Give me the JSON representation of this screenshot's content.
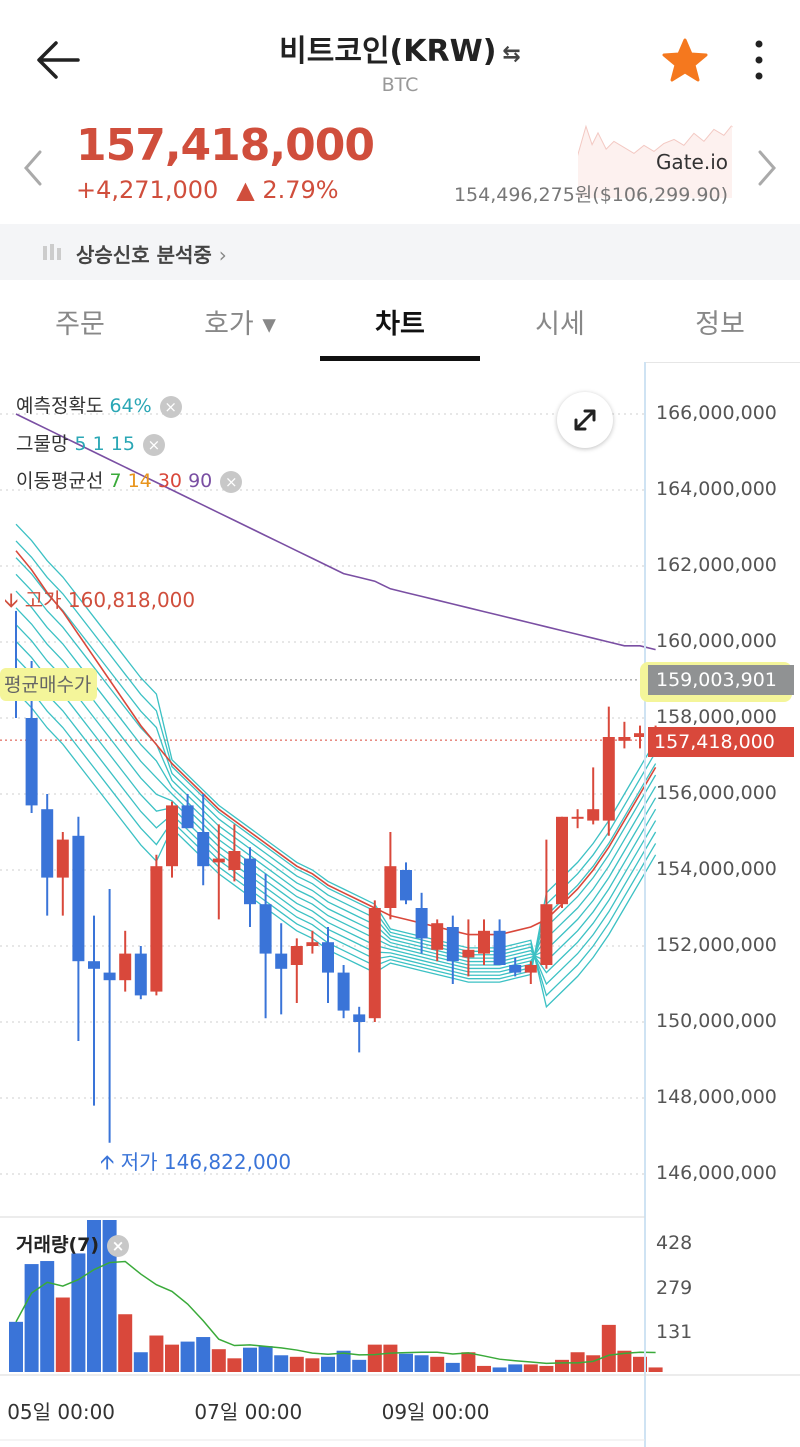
{
  "header": {
    "title": "비트코인(KRW)",
    "swap_icon": "⇆",
    "symbol": "BTC",
    "back_icon": "arrow-left-icon",
    "star_color": "#f5781e",
    "more_icon": "more-vertical-icon"
  },
  "ticker": {
    "price": "157,418,000",
    "change": "+4,271,000",
    "change_pct": "▲ 2.79%",
    "ref_exchange": "Gate.io",
    "ref_price": "154,496,275원($106,299.90)",
    "up_color": "#d04e3c"
  },
  "signal_bar": {
    "label": "상승신호 분석중",
    "chevron": "›"
  },
  "tabs": [
    {
      "label": "주문"
    },
    {
      "label": "호가 ▾"
    },
    {
      "label": "차트"
    },
    {
      "label": "시세"
    },
    {
      "label": "정보"
    }
  ],
  "active_tab": 2,
  "indicators": {
    "accuracy_label": "예측정확도",
    "accuracy_value": "64%",
    "grid_label": "그물망",
    "grid_params": "5 1 15",
    "ma_label": "이동평균선",
    "ma_7": "7",
    "ma_14": "14",
    "ma_30": "30",
    "ma_90": "90",
    "close": "×"
  },
  "chart_markers": {
    "high_label": "고가 160,818,000",
    "low_label": "저가 146,822,000",
    "avg_buy_label": "평균매수가",
    "avg_buy_value": "159,003,901",
    "current_value": "157,418,000"
  },
  "volume": {
    "label": "거래량(7)"
  },
  "chart_data": {
    "type": "candlestick",
    "ylim": [
      145000000,
      167000000
    ],
    "y_ticks": [
      "166,000,000",
      "164,000,000",
      "162,000,000",
      "160,000,000",
      "158,000,000",
      "156,000,000",
      "154,000,000",
      "152,000,000",
      "150,000,000",
      "148,000,000",
      "146,000,000"
    ],
    "y_tick_values": [
      166000000,
      164000000,
      162000000,
      160000000,
      158000000,
      156000000,
      154000000,
      152000000,
      150000000,
      148000000,
      146000000
    ],
    "x_ticks": [
      "05일 00:00",
      "07일 00:00",
      "09일 00:00"
    ],
    "x_tick_index": [
      2,
      14,
      26
    ],
    "avg_buy_price": 159003901,
    "current_price": 157418000,
    "colors": {
      "up": "#d9483b",
      "down": "#3a74d8",
      "ma7": "#d9483b",
      "ma90": "#7a4fa3",
      "grid": "#3cc1c4",
      "vol_ma": "#3aaa3a"
    },
    "candles": [
      {
        "o": 158900000,
        "h": 160818000,
        "l": 158000000,
        "c": 158800000
      },
      {
        "o": 158000000,
        "h": 159500000,
        "l": 155500000,
        "c": 155700000
      },
      {
        "o": 155600000,
        "h": 156000000,
        "l": 152800000,
        "c": 153800000
      },
      {
        "o": 153800000,
        "h": 155000000,
        "l": 152800000,
        "c": 154800000
      },
      {
        "o": 154900000,
        "h": 155400000,
        "l": 149500000,
        "c": 151600000
      },
      {
        "o": 151600000,
        "h": 152800000,
        "l": 147800000,
        "c": 151400000
      },
      {
        "o": 151300000,
        "h": 153500000,
        "l": 146822000,
        "c": 151100000
      },
      {
        "o": 151100000,
        "h": 152400000,
        "l": 150800000,
        "c": 151800000
      },
      {
        "o": 151800000,
        "h": 152000000,
        "l": 150600000,
        "c": 150700000
      },
      {
        "o": 150800000,
        "h": 154400000,
        "l": 150700000,
        "c": 154100000
      },
      {
        "o": 154100000,
        "h": 155800000,
        "l": 153800000,
        "c": 155700000
      },
      {
        "o": 155700000,
        "h": 156000000,
        "l": 155100000,
        "c": 155100000
      },
      {
        "o": 155000000,
        "h": 156000000,
        "l": 153600000,
        "c": 154100000
      },
      {
        "o": 154200000,
        "h": 155200000,
        "l": 152700000,
        "c": 154300000
      },
      {
        "o": 154000000,
        "h": 155200000,
        "l": 153700000,
        "c": 154500000
      },
      {
        "o": 154300000,
        "h": 154600000,
        "l": 152500000,
        "c": 153100000
      },
      {
        "o": 153100000,
        "h": 153900000,
        "l": 150100000,
        "c": 151800000
      },
      {
        "o": 151800000,
        "h": 152600000,
        "l": 150200000,
        "c": 151400000
      },
      {
        "o": 151500000,
        "h": 152200000,
        "l": 150500000,
        "c": 152000000
      },
      {
        "o": 152000000,
        "h": 152400000,
        "l": 151800000,
        "c": 152100000
      },
      {
        "o": 152100000,
        "h": 152500000,
        "l": 150500000,
        "c": 151300000
      },
      {
        "o": 151300000,
        "h": 151500000,
        "l": 150100000,
        "c": 150300000
      },
      {
        "o": 150200000,
        "h": 150400000,
        "l": 149200000,
        "c": 150000000
      },
      {
        "o": 150100000,
        "h": 153200000,
        "l": 150000000,
        "c": 153000000
      },
      {
        "o": 153000000,
        "h": 155000000,
        "l": 152700000,
        "c": 154100000
      },
      {
        "o": 154000000,
        "h": 154200000,
        "l": 153100000,
        "c": 153200000
      },
      {
        "o": 153000000,
        "h": 153400000,
        "l": 151800000,
        "c": 152200000
      },
      {
        "o": 151900000,
        "h": 152700000,
        "l": 151600000,
        "c": 152600000
      },
      {
        "o": 152500000,
        "h": 152800000,
        "l": 151000000,
        "c": 151600000
      },
      {
        "o": 151700000,
        "h": 152700000,
        "l": 151200000,
        "c": 151900000
      },
      {
        "o": 151800000,
        "h": 152700000,
        "l": 151500000,
        "c": 152400000
      },
      {
        "o": 152400000,
        "h": 152700000,
        "l": 151500000,
        "c": 151500000
      },
      {
        "o": 151500000,
        "h": 151700000,
        "l": 151200000,
        "c": 151300000
      },
      {
        "o": 151300000,
        "h": 151600000,
        "l": 151000000,
        "c": 151500000
      },
      {
        "o": 151500000,
        "h": 154800000,
        "l": 151400000,
        "c": 153100000
      },
      {
        "o": 153100000,
        "h": 155400000,
        "l": 153000000,
        "c": 155400000
      },
      {
        "o": 155400000,
        "h": 155600000,
        "l": 155100000,
        "c": 155400000
      },
      {
        "o": 155300000,
        "h": 156700000,
        "l": 155200000,
        "c": 155600000
      },
      {
        "o": 155300000,
        "h": 158300000,
        "l": 154900000,
        "c": 157500000
      },
      {
        "o": 157400000,
        "h": 157900000,
        "l": 157200000,
        "c": 157500000
      },
      {
        "o": 157500000,
        "h": 157800000,
        "l": 157200000,
        "c": 157600000
      },
      {
        "o": 157400000,
        "h": 157800000,
        "l": 157000000,
        "c": 157418000
      }
    ],
    "ma7": [
      162400000,
      161900000,
      161300000,
      160800000,
      160200000,
      159600000,
      159000000,
      158400000,
      157800000,
      157300000,
      156800000,
      156400000,
      156000000,
      155600000,
      155300000,
      155000000,
      154700000,
      154400000,
      154100000,
      153900000,
      153600000,
      153400000,
      153200000,
      153000000,
      152800000,
      152700000,
      152600000,
      152500000,
      152400000,
      152300000,
      152300000,
      152300000,
      152400000,
      152500000,
      152700000,
      153100000,
      153500000,
      154000000,
      154600000,
      155300000,
      156000000,
      156700000
    ],
    "ma90": [
      166000000,
      165800000,
      165600000,
      165400000,
      165200000,
      165000000,
      164800000,
      164600000,
      164400000,
      164200000,
      164000000,
      163800000,
      163600000,
      163400000,
      163200000,
      163000000,
      162800000,
      162600000,
      162400000,
      162200000,
      162000000,
      161800000,
      161700000,
      161600000,
      161400000,
      161300000,
      161200000,
      161100000,
      161000000,
      160900000,
      160800000,
      160700000,
      160600000,
      160500000,
      160400000,
      160300000,
      160200000,
      160100000,
      160000000,
      159900000,
      159900000,
      159800000
    ],
    "volume": [
      0.33,
      0.71,
      0.73,
      0.49,
      0.78,
      1.0,
      1.0,
      0.38,
      0.13,
      0.24,
      0.18,
      0.2,
      0.23,
      0.15,
      0.09,
      0.16,
      0.17,
      0.11,
      0.1,
      0.09,
      0.1,
      0.14,
      0.08,
      0.18,
      0.18,
      0.12,
      0.11,
      0.1,
      0.06,
      0.13,
      0.04,
      0.03,
      0.05,
      0.05,
      0.04,
      0.08,
      0.13,
      0.11,
      0.31,
      0.14,
      0.1,
      0.03
    ],
    "vol_ticks": [
      "428",
      "279",
      "131"
    ],
    "vol_tick_values": [
      428,
      279,
      131
    ],
    "vol_max": 510
  }
}
